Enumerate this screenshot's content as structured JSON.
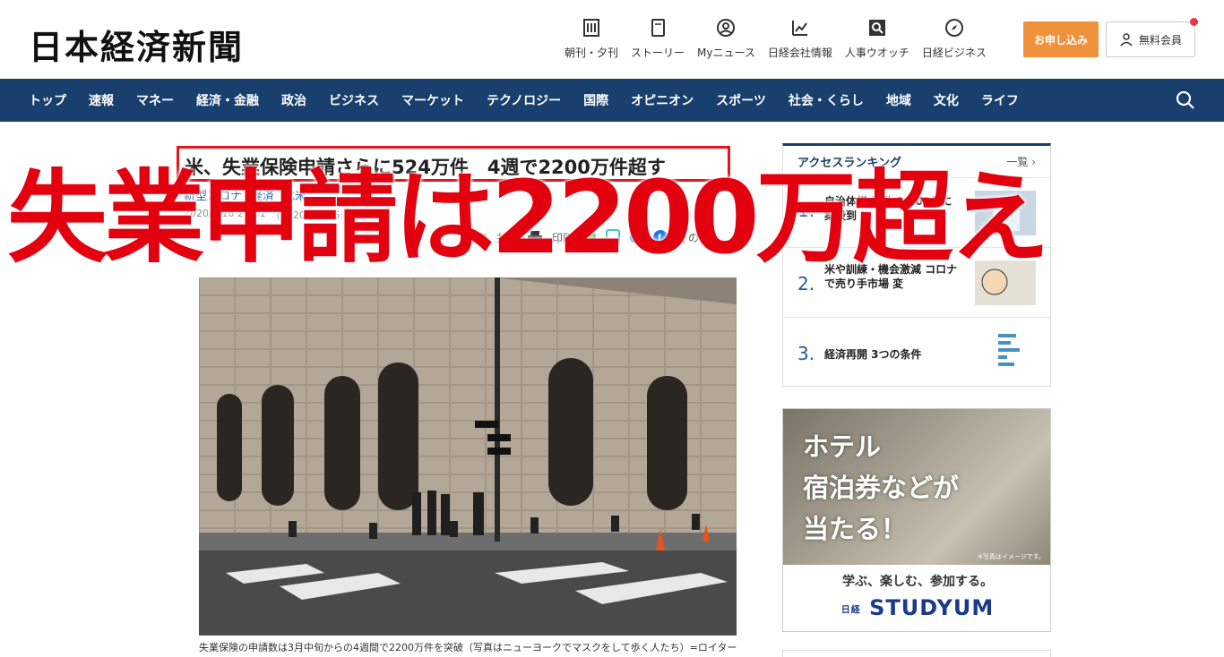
{
  "header": {
    "logo": "日本経済新聞",
    "icons": [
      {
        "label": "朝刊・夕刊",
        "icon": "newspaper-icon"
      },
      {
        "label": "ストーリー",
        "icon": "book-icon"
      },
      {
        "label": "Myニュース",
        "icon": "user-circle-icon"
      },
      {
        "label": "日経会社情報",
        "icon": "chart-icon"
      },
      {
        "label": "人事ウオッチ",
        "icon": "search-person-icon"
      },
      {
        "label": "日経ビジネス",
        "icon": "compass-icon"
      }
    ],
    "apply_label": "お申し込み",
    "member_label": "無料会員",
    "colors": {
      "apply": "#f0923b",
      "notif": "#e63946"
    }
  },
  "nav": {
    "items": [
      "トップ",
      "速報",
      "マネー",
      "経済・金融",
      "政治",
      "ビジネス",
      "マーケット",
      "テクノロジー",
      "国際",
      "オピニオン",
      "スポーツ",
      "社会・くらし",
      "地域",
      "文化",
      "ライフ"
    ],
    "background": "#183f6e"
  },
  "article": {
    "headline": "米、失業保険申請さらに524万件　4週で2200万件超す",
    "tags": [
      "新型コロナ",
      "経済",
      "北米"
    ],
    "dates": [
      "2020/4/16 21:31",
      "(2020/4/17 5:37更新)"
    ],
    "share": {
      "save": "保存",
      "share": "共有",
      "print": "印刷",
      "other": "その他"
    },
    "caption": "失業保険の申請数は3月中旬からの4週間で2200万件を突破（写真はニューヨークでマスクをして歩く人たち）=ロイター"
  },
  "overlay": {
    "title": "失業申請は2200万超え",
    "color": "#e3000f"
  },
  "sidebar": {
    "ranking_title": "アクセスランキング",
    "ranking_more": "一覧",
    "items": [
      {
        "num": "1.",
        "text": "自治体様 活動 1,000件に 案殺到"
      },
      {
        "num": "2.",
        "text": "米や訓練・機会激減 コロナで売り手市場 変"
      },
      {
        "num": "3.",
        "text": "経済再開 3つの条件"
      }
    ],
    "ad": {
      "line1": "ホテル",
      "line2": "宿泊券などが",
      "line3": "当たる！",
      "note": "※写真はイメージです。",
      "tagline": "学ぶ、楽しむ、参加する。",
      "logo_small": "日経",
      "logo": "STUDYUM"
    }
  }
}
